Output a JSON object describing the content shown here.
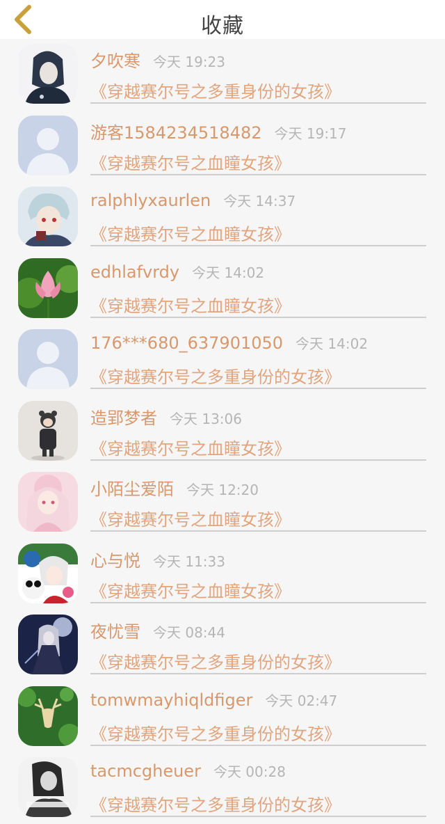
{
  "header": {
    "title": "收藏",
    "back_icon": "chevron-left-icon",
    "accent": "#c9a13a"
  },
  "colors": {
    "name": "#d9986c",
    "time": "#b5b5b5",
    "book": "#e0a57e"
  },
  "items": [
    {
      "name": "夕吹寒",
      "time": "今天 19:23",
      "book": "《穿越赛尔号之多重身份的女孩》",
      "avatar": "anime-girl-avatar"
    },
    {
      "name": "游客1584234518482",
      "time": "今天 19:17",
      "book": "《穿越赛尔号之血瞳女孩》",
      "avatar": "default-user-avatar"
    },
    {
      "name": "ralphlyxaurlen",
      "time": "今天 14:37",
      "book": "《穿越赛尔号之血瞳女孩》",
      "avatar": "anime-boy-avatar"
    },
    {
      "name": "edhlafvrdy",
      "time": "今天 14:02",
      "book": "《穿越赛尔号之血瞳女孩》",
      "avatar": "lotus-avatar"
    },
    {
      "name": "176***680_637901050",
      "time": "今天 14:02",
      "book": "《穿越赛尔号之多重身份的女孩》",
      "avatar": "default-user-avatar"
    },
    {
      "name": "造郢梦者",
      "time": "今天 13:06",
      "book": "《穿越赛尔号之血瞳女孩》",
      "avatar": "child-photo-avatar"
    },
    {
      "name": "小陌尘爱陌",
      "time": "今天 12:20",
      "book": "《穿越赛尔号之血瞳女孩》",
      "avatar": "pink-anime-avatar"
    },
    {
      "name": "心与悦",
      "time": "今天 11:33",
      "book": "《穿越赛尔号之血瞳女孩》",
      "avatar": "panda-anime-avatar"
    },
    {
      "name": "夜忧雪",
      "time": "今天 08:44",
      "book": "《穿越赛尔号之多重身份的女孩》",
      "avatar": "night-anime-avatar"
    },
    {
      "name": "tomwmayhiqldfiger",
      "time": "今天 02:47",
      "book": "《穿越赛尔号之多重身份的女孩》",
      "avatar": "deer-avatar"
    },
    {
      "name": "tacmcgheuer",
      "time": "今天 00:28",
      "book": "《穿越赛尔号之多重身份的女孩》",
      "avatar": "bw-photo-avatar"
    }
  ]
}
